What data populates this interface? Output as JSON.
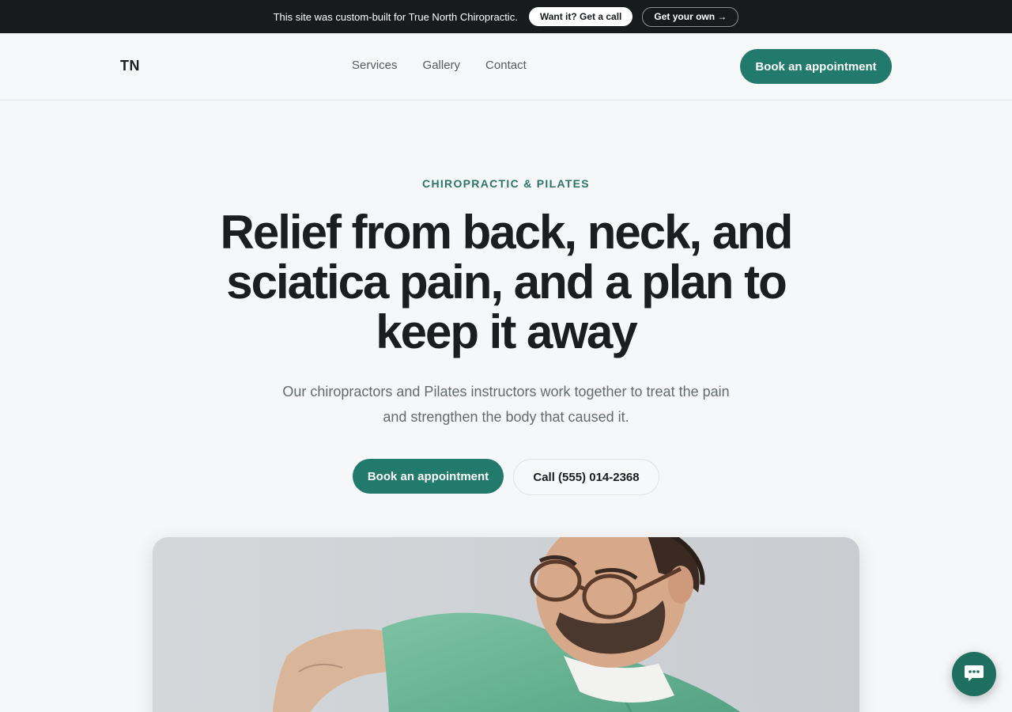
{
  "promo": {
    "text": "This site was custom-built for True North Chiropractic.",
    "primary_label": "Want it? Get a call",
    "secondary_label": "Get your own →"
  },
  "header": {
    "logo": "TN",
    "nav": [
      "Services",
      "Gallery",
      "Contact"
    ],
    "cta_label": "Book an appointment"
  },
  "hero": {
    "eyebrow": "CHIROPRACTIC & PILATES",
    "headline": "Relief from back, neck, and sciatica pain, and a plan to keep it away",
    "subhead": "Our chiropractors and Pilates instructors work together to treat the pain and strengthen the body that caused it.",
    "primary_cta": "Book an appointment",
    "secondary_cta": "Call (555) 014-2368"
  },
  "icons": {
    "chat": "chat-bubble-icon"
  },
  "colors": {
    "accent": "#217a6b",
    "promo_bg": "#171b1c",
    "page_bg": "#f5f7f8"
  }
}
